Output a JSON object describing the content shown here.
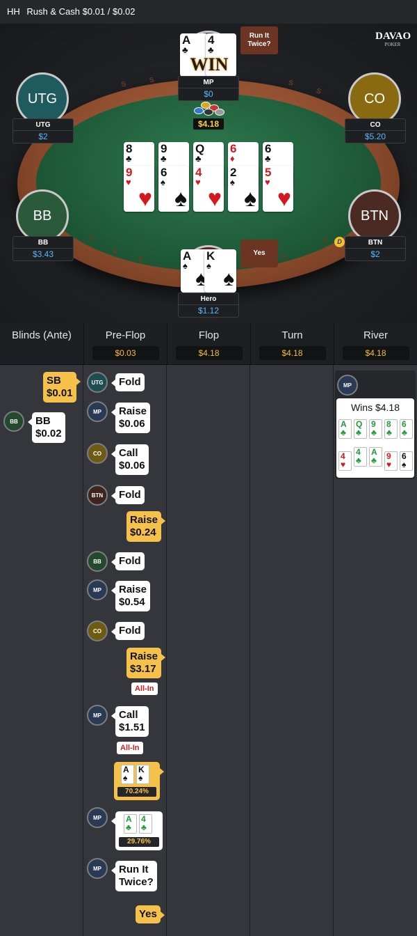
{
  "header": {
    "hh": "HH",
    "title": "Rush & Cash $0.01 / $0.02"
  },
  "logo": {
    "line1": "DAVAO",
    "line2": "POKER"
  },
  "table": {
    "pot": "$4.18",
    "win_label": "WIN",
    "speech_mp": "Run It Twice?",
    "speech_hero": "Yes",
    "dealer_button": "D",
    "rail_letters": [
      "S",
      "S",
      "S",
      "S",
      "U",
      "S",
      "S",
      "A",
      "S"
    ],
    "seats": [
      {
        "id": "utg",
        "avatar": "UTG",
        "name": "UTG",
        "stack": "$2",
        "color": "#1e5a5e"
      },
      {
        "id": "co",
        "avatar": "CO",
        "name": "CO",
        "stack": "$5.20",
        "color": "#8a6a10"
      },
      {
        "id": "bb",
        "avatar": "BB",
        "name": "BB",
        "stack": "$3.43",
        "color": "#2a5a3a"
      },
      {
        "id": "btn",
        "avatar": "BTN",
        "name": "BTN",
        "stack": "$2",
        "color": "#4a2a22"
      },
      {
        "id": "mp",
        "avatar": "",
        "name": "MP",
        "stack": "$0",
        "color": "#2a3a55"
      },
      {
        "id": "hero",
        "avatar": "",
        "name": "Hero",
        "stack": "$1.12",
        "color": "#6a2020"
      }
    ],
    "mp_cards": [
      {
        "rank": "A",
        "suit": "♣",
        "color": "blk"
      },
      {
        "rank": "4",
        "suit": "♣",
        "color": "blk"
      }
    ],
    "hero_cards": [
      {
        "rank": "A",
        "suit": "♠",
        "color": "blk"
      },
      {
        "rank": "K",
        "suit": "♠",
        "color": "blk"
      }
    ],
    "board_top": [
      {
        "rank": "8",
        "suit": "♣",
        "color": "blk"
      },
      {
        "rank": "9",
        "suit": "♣",
        "color": "blk"
      },
      {
        "rank": "Q",
        "suit": "♣",
        "color": "blk"
      },
      {
        "rank": "6",
        "suit": "♦",
        "color": "red"
      },
      {
        "rank": "6",
        "suit": "♣",
        "color": "blk"
      }
    ],
    "board_bottom": [
      {
        "rank": "9",
        "suit": "♥",
        "color": "red"
      },
      {
        "rank": "6",
        "suit": "♠",
        "color": "blk"
      },
      {
        "rank": "4",
        "suit": "♥",
        "color": "red"
      },
      {
        "rank": "2",
        "suit": "♠",
        "color": "blk"
      },
      {
        "rank": "5",
        "suit": "♥",
        "color": "red"
      }
    ]
  },
  "columns": [
    {
      "title": "Blinds (Ante)",
      "pot": ""
    },
    {
      "title": "Pre-Flop",
      "pot": "$0.03"
    },
    {
      "title": "Flop",
      "pot": "$4.18"
    },
    {
      "title": "Turn",
      "pot": "$4.18"
    },
    {
      "title": "River",
      "pot": "$4.18"
    }
  ],
  "blinds": {
    "sb": {
      "action": "SB",
      "amount": "$0.01"
    },
    "bb": {
      "badge": "BB",
      "action": "BB",
      "amount": "$0.02"
    }
  },
  "preflop": [
    {
      "badge": "UTG",
      "line1": "Fold",
      "line2": ""
    },
    {
      "badge": "MP",
      "line1": "Raise",
      "line2": "$0.06"
    },
    {
      "badge": "CO",
      "line1": "Call",
      "line2": "$0.06"
    },
    {
      "badge": "BTN",
      "line1": "Fold",
      "line2": ""
    },
    {
      "badge": "",
      "line1": "Raise",
      "line2": "$0.24"
    },
    {
      "badge": "BB",
      "line1": "Fold",
      "line2": ""
    },
    {
      "badge": "MP",
      "line1": "Raise",
      "line2": "$0.54"
    },
    {
      "badge": "CO",
      "line1": "Fold",
      "line2": ""
    },
    {
      "badge": "",
      "line1": "Raise",
      "line2": "$3.17"
    },
    {
      "badge": "MP",
      "line1": "Call",
      "line2": "$1.51"
    }
  ],
  "allin_label": "All-In",
  "hero_show": {
    "cards": [
      {
        "rank": "A",
        "suit": "♠"
      },
      {
        "rank": "K",
        "suit": "♠"
      }
    ],
    "equity": "70.24%"
  },
  "mp_show": {
    "badge": "MP",
    "cards": [
      {
        "rank": "A",
        "suit": "♣"
      },
      {
        "rank": "4",
        "suit": "♣"
      }
    ],
    "equity": "29.76%"
  },
  "rit": {
    "badge": "MP",
    "line1": "Run It",
    "line2": "Twice?",
    "reply": "Yes"
  },
  "river": {
    "badge": "MP",
    "wins": "Wins $4.18",
    "row1": [
      {
        "rank": "A",
        "suit": "♣",
        "color": "grn"
      },
      {
        "rank": "Q",
        "suit": "♣",
        "color": "grn"
      },
      {
        "rank": "9",
        "suit": "♣",
        "color": "grn"
      },
      {
        "rank": "8",
        "suit": "♣",
        "color": "grn"
      },
      {
        "rank": "6",
        "suit": "♣",
        "color": "grn"
      }
    ],
    "row2": [
      {
        "rank": "4",
        "suit": "♥",
        "color": "red"
      },
      {
        "rank": "4",
        "suit": "♣",
        "color": "grn"
      },
      {
        "rank": "A",
        "suit": "♣",
        "color": "grn"
      },
      {
        "rank": "9",
        "suit": "♥",
        "color": "red"
      },
      {
        "rank": "6",
        "suit": "♠",
        "color": "blk"
      }
    ]
  }
}
